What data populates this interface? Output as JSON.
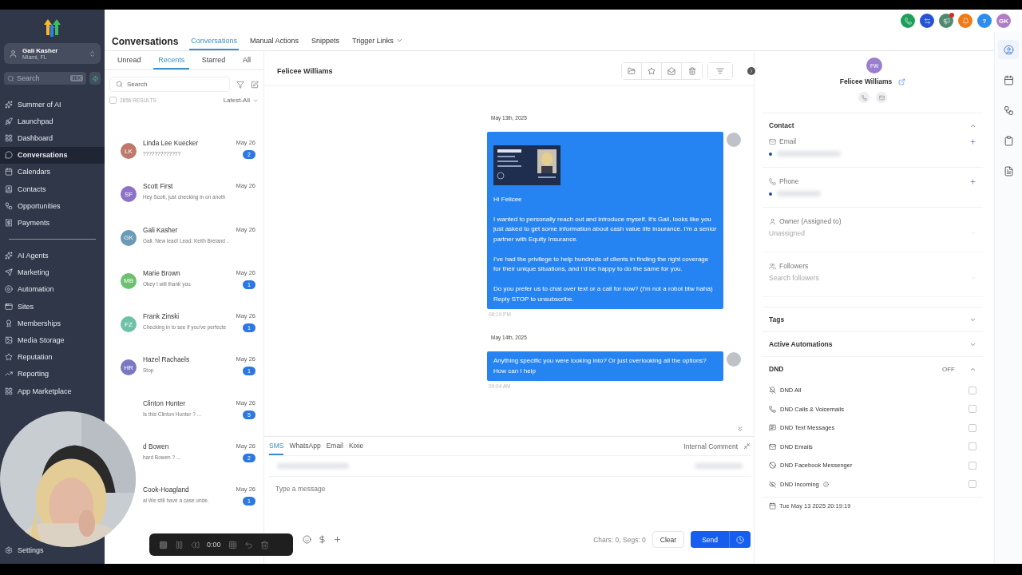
{
  "sidebar": {
    "account": {
      "name": "Gali Kasher",
      "location": "Miami, FL"
    },
    "search": {
      "placeholder": "Search",
      "shortcut": "⌘K"
    },
    "groups": [
      [
        {
          "label": "Summer of AI",
          "selected": false
        },
        {
          "label": "Launchpad",
          "selected": false
        },
        {
          "label": "Dashboard",
          "selected": false
        },
        {
          "label": "Conversations",
          "selected": true
        },
        {
          "label": "Calendars",
          "selected": false
        },
        {
          "label": "Contacts",
          "selected": false
        },
        {
          "label": "Opportunities",
          "selected": false
        },
        {
          "label": "Payments",
          "selected": false
        }
      ],
      [
        {
          "label": "AI Agents",
          "selected": false
        },
        {
          "label": "Marketing",
          "selected": false
        },
        {
          "label": "Automation",
          "selected": false
        },
        {
          "label": "Sites",
          "selected": false
        },
        {
          "label": "Memberships",
          "selected": false
        },
        {
          "label": "Media Storage",
          "selected": false
        },
        {
          "label": "Reputation",
          "selected": false
        },
        {
          "label": "Reporting",
          "selected": false
        },
        {
          "label": "App Marketplace",
          "selected": false
        }
      ]
    ],
    "settings": "Settings"
  },
  "header": {
    "actions": [
      {
        "kind": "phone",
        "color": "#1e9e5a"
      },
      {
        "kind": "switch",
        "color": "#2553d8"
      },
      {
        "kind": "megaphone",
        "color": "#4f8a6e",
        "badge": true
      },
      {
        "kind": "bell",
        "color": "#f07a14"
      },
      {
        "kind": "help",
        "color": "#2d8cf0",
        "label": "?"
      },
      {
        "kind": "avatar",
        "color": "#b07cc6",
        "label": "GK"
      }
    ]
  },
  "page": {
    "title": "Conversations",
    "tabs": [
      {
        "label": "Conversations",
        "selected": true
      },
      {
        "label": "Manual Actions",
        "selected": false
      },
      {
        "label": "Snippets",
        "selected": false
      },
      {
        "label": "Trigger Links",
        "selected": false,
        "dropdown": true
      }
    ]
  },
  "list": {
    "filters": [
      {
        "label": "Unread",
        "selected": false
      },
      {
        "label": "Recents",
        "selected": true
      },
      {
        "label": "Starred",
        "selected": false
      },
      {
        "label": "All",
        "selected": false
      }
    ],
    "search": {
      "placeholder": "Search"
    },
    "select_all": {
      "checked": false
    },
    "results": "2856 RESULTS",
    "sort": "Latest-All",
    "items": [
      {
        "name": "Linda Lee Kuecker",
        "preview": "?????????????",
        "date": "May 26",
        "unread": "2",
        "initials": "LK",
        "color": "#c0786a"
      },
      {
        "name": "Scott First",
        "preview": "Hey Scott, just checking in on anoth",
        "date": "May 26",
        "initials": "SF",
        "color": "#8e72c9"
      },
      {
        "name": "Gali Kasher",
        "preview": "Gali, New lead! Lead: Keith Breland ..",
        "date": "May 26",
        "initials": "GK",
        "color": "#6a9ab5"
      },
      {
        "name": "Marie Brown",
        "preview": "Okey I will thank you",
        "date": "May 26",
        "unread": "1",
        "initials": "MB",
        "color": "#6cc070"
      },
      {
        "name": "Frank Zinski",
        "preview": "Checking in to see if you've perfecte",
        "date": "May 26",
        "unread": "1",
        "initials": "FZ",
        "color": "#6ec1a6"
      },
      {
        "name": "Hazel Rachaels",
        "preview": "Stop",
        "date": "May 26",
        "unread": "1",
        "initials": "HR",
        "color": "#7a78c4"
      },
      {
        "name": "Clinton Hunter",
        "preview": "Is this Clinton Hunter ? ...",
        "date": "May 26",
        "unread": "5"
      },
      {
        "name": "d Bowen",
        "preview": "hard Bowen ? ...",
        "date": "May 26",
        "unread": "2"
      },
      {
        "name": "Cook-Hoagland",
        "preview": "al We still have a case unde.",
        "date": "May 26",
        "unread": "1"
      }
    ]
  },
  "chat": {
    "contact": "Felicee Williams",
    "messages": [
      {
        "date": "May 13th, 2025",
        "attachment": true,
        "paragraphs": [
          "Hi Felicee",
          "I wanted to personally reach out and introduce myself. It's Gali, looks like you just asked to get some information about cash value life insurance. I'm a senior partner with Equity Insurance.",
          "I've had the privilege to help hundreds of clients in finding the right coverage for their unique situations, and I'd be happy to do the same for you.",
          "Do you prefer us to chat over text or a call for now? (I'm not a robot btw haha)\nReply STOP to unsubscribe."
        ],
        "time": "08:19 PM"
      },
      {
        "date": "May 14th, 2025",
        "attachment": false,
        "paragraphs": [
          "Anything specific you were looking into? Or just overlooking all the options? How can I help"
        ],
        "time": "09:04 AM"
      }
    ]
  },
  "composer": {
    "channels": [
      {
        "label": "SMS",
        "selected": true
      },
      {
        "label": "WhatsApp",
        "selected": false
      },
      {
        "label": "Email",
        "selected": false
      },
      {
        "label": "Kixie",
        "selected": false
      }
    ],
    "internal": "Internal Comment",
    "placeholder": "Type a message",
    "counter": "Chars: 0, Segs: 0",
    "clear": "Clear",
    "send": "Send"
  },
  "recorder": {
    "time": "0:00"
  },
  "contact_panel": {
    "initials": "FW",
    "name": "Felicee Williams",
    "contact": {
      "title": "Contact",
      "expanded": true,
      "fields": [
        {
          "label": "Email"
        },
        {
          "label": "Phone"
        }
      ]
    },
    "owner": {
      "label": "Owner (Assigned to)",
      "value": "Unassigned"
    },
    "followers": {
      "label": "Followers",
      "placeholder": "Search followers"
    },
    "sections": [
      {
        "title": "Tags",
        "expanded": false
      },
      {
        "title": "Active Automations",
        "expanded": false
      }
    ],
    "dnd": {
      "title": "DND",
      "status": "OFF",
      "expanded": true,
      "options": [
        {
          "label": "DND All",
          "checked": false
        },
        {
          "label": "DND Calls & Voicemails",
          "checked": false
        },
        {
          "label": "DND Text Messages",
          "checked": false
        },
        {
          "label": "DND Emails",
          "checked": false
        },
        {
          "label": "DND Facebook Messenger",
          "checked": false
        },
        {
          "label": "DND Incoming",
          "checked": false,
          "info": true
        }
      ]
    },
    "created": "Tue May 13 2025 20:19:19"
  },
  "rail": [
    {
      "selected": true
    },
    {
      "selected": false
    },
    {
      "selected": false
    },
    {
      "selected": false
    },
    {
      "selected": false
    }
  ]
}
